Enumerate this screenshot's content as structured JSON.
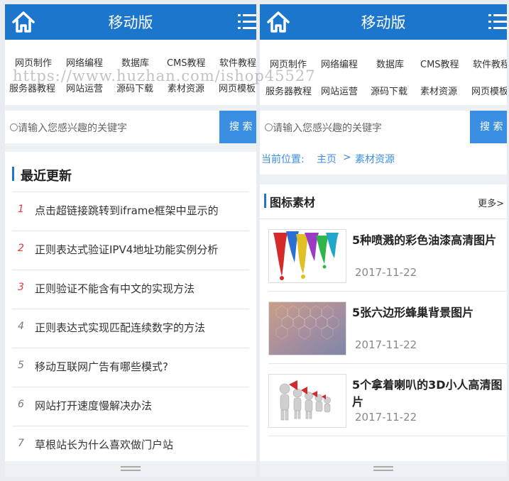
{
  "header": {
    "title": "移动版"
  },
  "nav": {
    "row1": [
      "网页制作",
      "网络编程",
      "数据库",
      "CMS教程",
      "软件教程"
    ],
    "row2": [
      "服务器教程",
      "网站运营",
      "源码下载",
      "素材资源",
      "网页模板"
    ]
  },
  "watermark": "https://www.huzhan.com/ishop45527",
  "search": {
    "placeholder": "请输入您感兴趣的关键字",
    "button": "搜 索"
  },
  "left": {
    "section_title": "最近更新",
    "items": [
      {
        "num": "1",
        "text": "点击超链接跳转到iframe框架中显示的"
      },
      {
        "num": "2",
        "text": "正则表达式验证IPV4地址功能实例分析"
      },
      {
        "num": "3",
        "text": "正则验证不能含有中文的实现方法"
      },
      {
        "num": "4",
        "text": "正则表达式实现匹配连续数字的方法"
      },
      {
        "num": "5",
        "text": "移动互联网广告有哪些模式?"
      },
      {
        "num": "6",
        "text": "网站打开速度慢解决办法"
      },
      {
        "num": "7",
        "text": "草根站长为什么喜欢做门户站"
      }
    ]
  },
  "right": {
    "breadcrumb": {
      "prefix": "当前位置:",
      "home": "主页",
      "sep": ">",
      "current": "素材资源"
    },
    "category": {
      "title": "图标素材",
      "more": "更多>"
    },
    "items": [
      {
        "title": "5种喷溅的彩色油漆高清图片",
        "date": "2017-11-22",
        "thumb": "paint-splash-thumbnail"
      },
      {
        "title": "5张六边形蜂巢背景图片",
        "date": "2017-11-22",
        "thumb": "hexagon-background-thumbnail"
      },
      {
        "title": "5个拿着喇叭的3D小人高清图片",
        "date": "2017-11-22",
        "thumb": "3d-people-megaphone-thumbnail"
      }
    ]
  },
  "colors": {
    "brand": "#1c77cc",
    "search_button": "#3b8fe3",
    "red_number": "#e03a3a"
  }
}
